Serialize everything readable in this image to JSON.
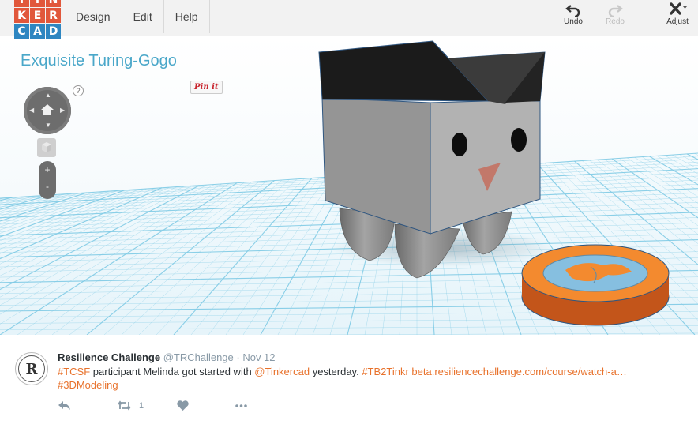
{
  "toolbar": {
    "logo_letters": [
      "T",
      "I",
      "N",
      "K",
      "E",
      "R",
      "C",
      "A",
      "D"
    ],
    "logo_colors": [
      "#e1573b",
      "#e1573b",
      "#e1573b",
      "#e1573b",
      "#e1573b",
      "#e1573b",
      "#2e86c1",
      "#2e86c1",
      "#2e86c1"
    ],
    "menu": [
      "Design",
      "Edit",
      "Help"
    ],
    "undo_label": "Undo",
    "redo_label": "Redo",
    "adjust_label": "Adjust"
  },
  "workplane": {
    "design_title": "Exquisite Turing-Gogo",
    "help_label": "?",
    "pin_label": "Pin it",
    "zoom_in": "+",
    "zoom_out": "-",
    "grid_color": "#7ecae4",
    "title_color": "#4aa7c9"
  },
  "tweet": {
    "avatar_letter": "R",
    "author_name": "Resilience Challenge",
    "handle": "@TRChallenge",
    "separator": " · ",
    "date": "Nov 12",
    "body": {
      "hashtag_tcsf": "#TCSF",
      "text_1": " participant Melinda got started with ",
      "mention": "@Tinkercad",
      "text_2": " yesterday. ",
      "hashtag_tb2tinkr": "#TB2Tinkr",
      "space": " ",
      "link": "beta.resiliencechallenge.com/course/watch-a…",
      "hashtag_3d": "#3DModeling"
    },
    "retweet_count": "1",
    "link_color": "#e8722c",
    "icons": [
      "reply-icon",
      "retweet-icon",
      "like-icon",
      "more-icon"
    ]
  }
}
